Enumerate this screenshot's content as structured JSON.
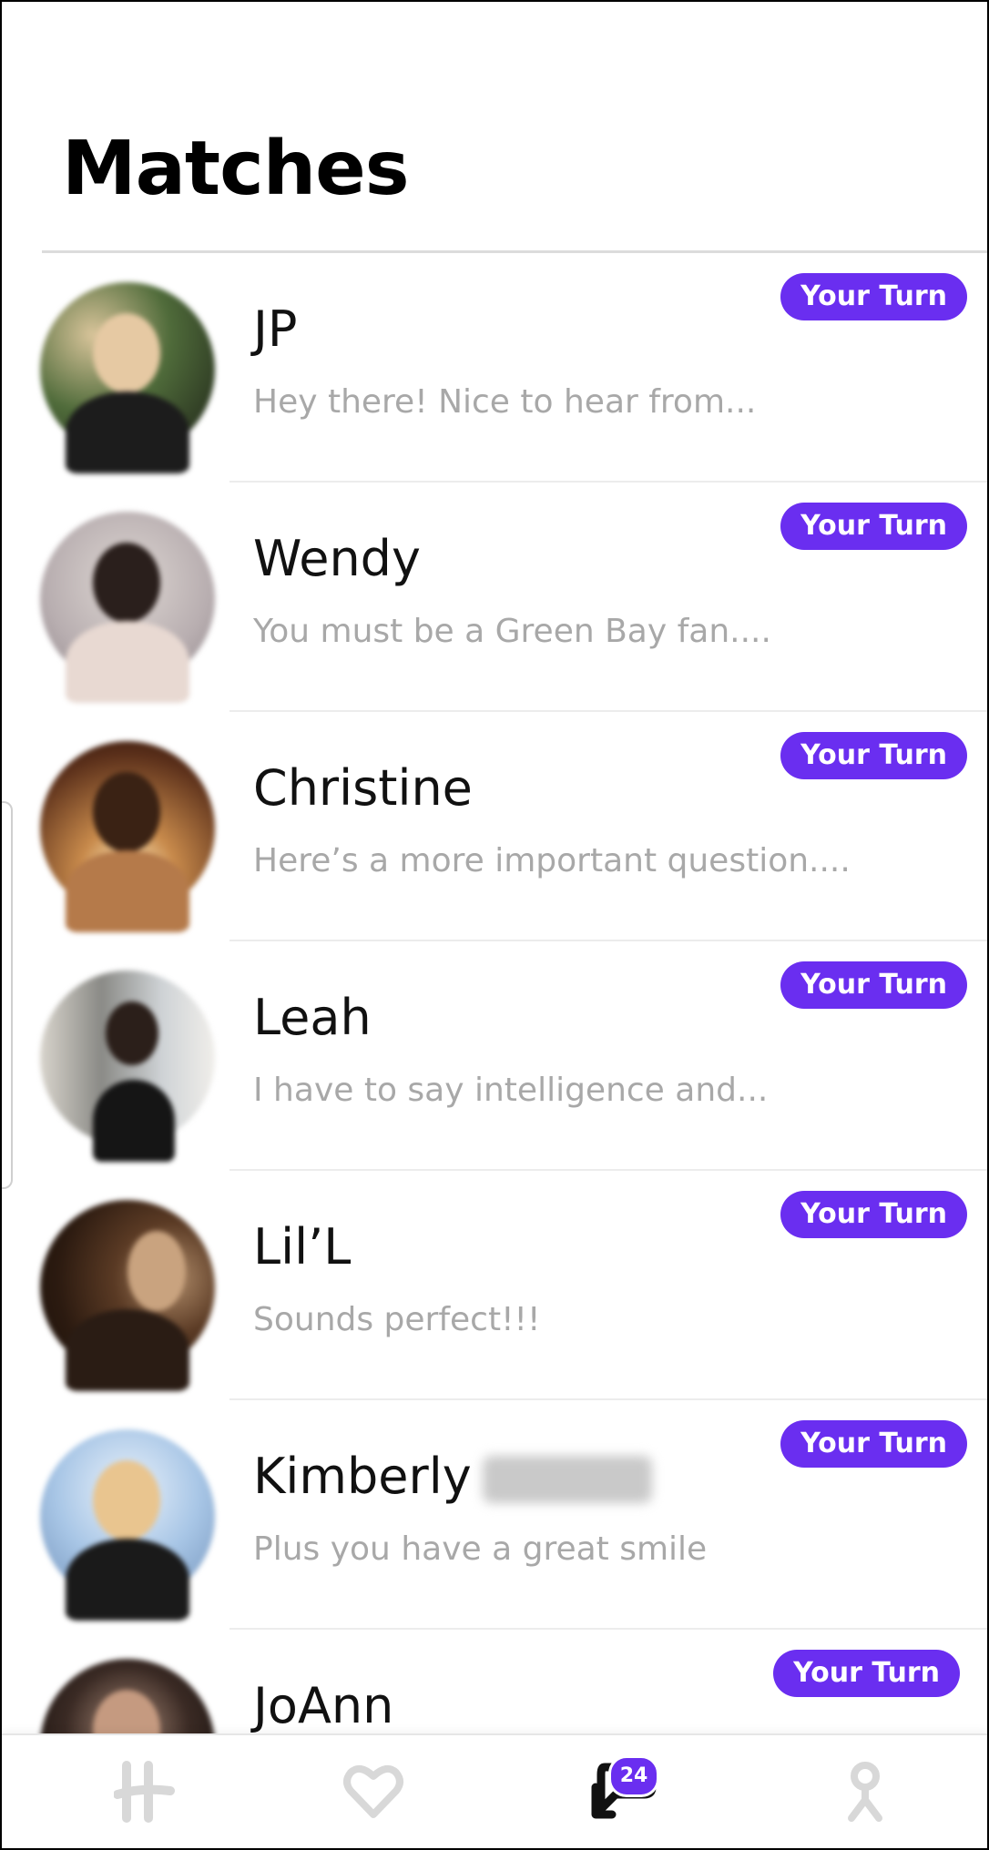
{
  "header": {
    "title": "Matches"
  },
  "colors": {
    "accent": "#6a2ef0",
    "name_text": "#111111",
    "preview_text": "#a8a8a8",
    "nav_inactive": "#d8d8d8",
    "nav_active": "#111111"
  },
  "matches": [
    {
      "name": "JP",
      "preview": "Hey there! Nice to hear from...",
      "badge": "Your Turn"
    },
    {
      "name": "Wendy",
      "preview": "You must be a Green Bay fan....",
      "badge": "Your Turn"
    },
    {
      "name": "Christine",
      "preview": "Here’s a more important question....",
      "badge": "Your Turn"
    },
    {
      "name": "Leah",
      "preview": "I have to say intelligence and...",
      "badge": "Your Turn"
    },
    {
      "name": "Lil’L",
      "preview": "Sounds perfect!!!",
      "badge": "Your Turn"
    },
    {
      "name": "Kimberly",
      "preview": "Plus you have a great smile",
      "badge": "Your Turn"
    },
    {
      "name": "JoAnn",
      "preview": "",
      "badge": "Your Turn"
    }
  ],
  "bottom_nav": {
    "items": [
      {
        "icon": "hinge-logo-icon",
        "active": false
      },
      {
        "icon": "heart-icon",
        "active": false
      },
      {
        "icon": "chat-icon",
        "active": true,
        "badge": "24"
      },
      {
        "icon": "profile-icon",
        "active": false
      }
    ]
  }
}
